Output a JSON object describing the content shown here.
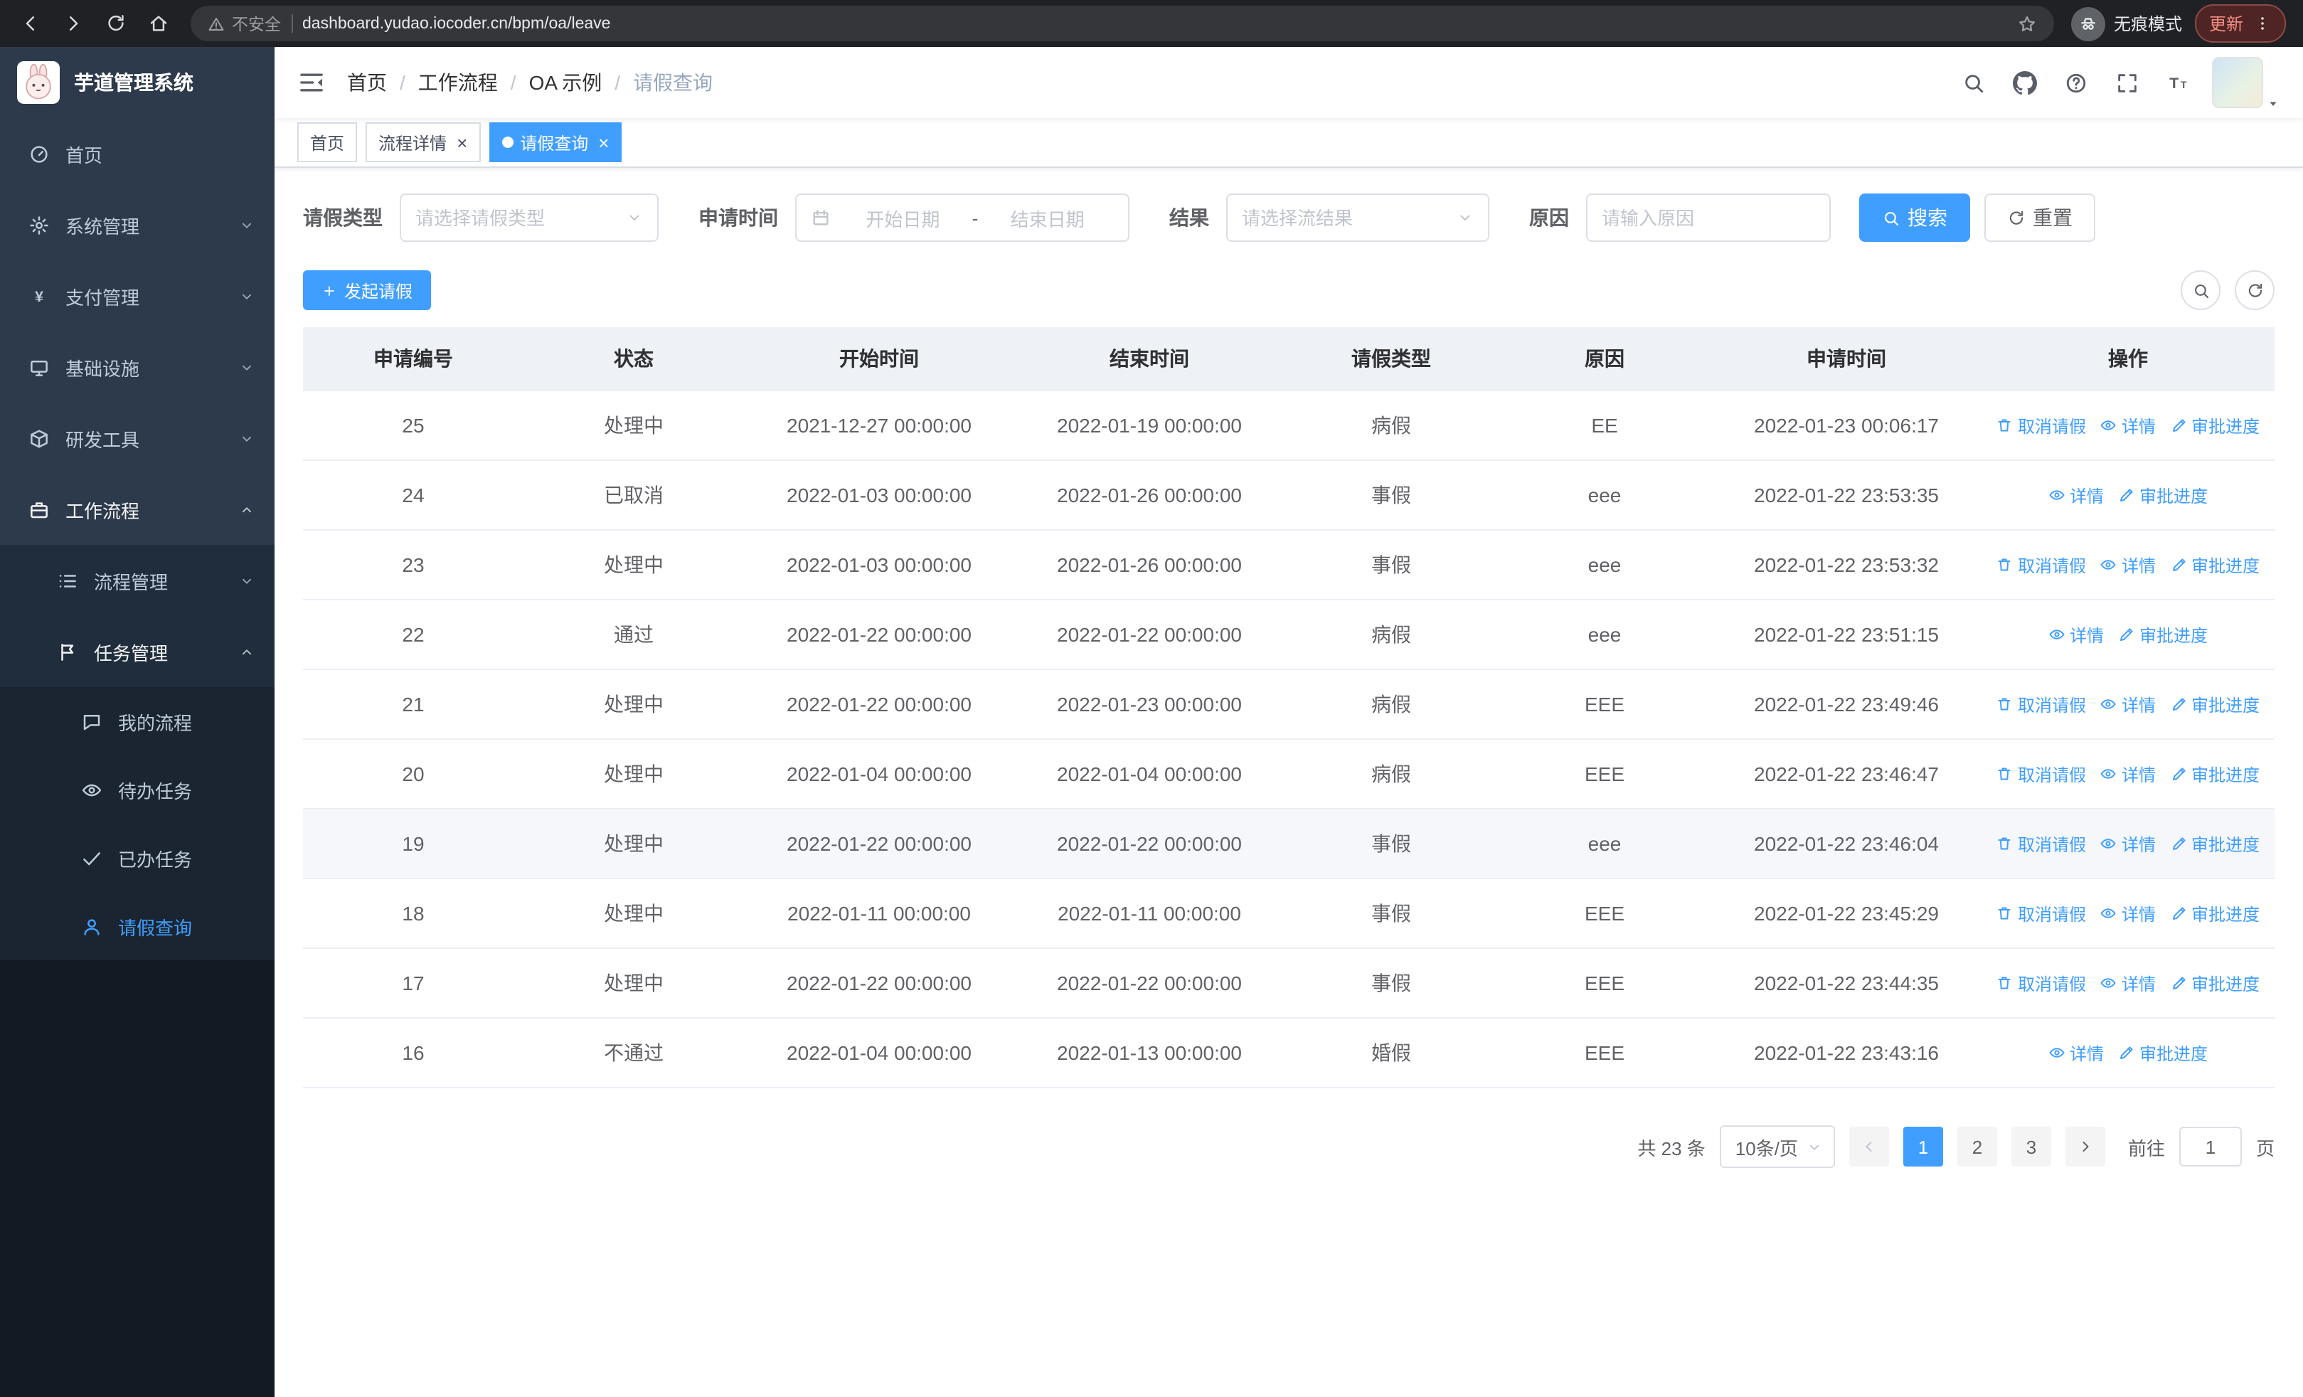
{
  "colors": {
    "primary": "#409eff"
  },
  "browser": {
    "security_label": "不安全",
    "url": "dashboard.yudao.iocoder.cn/bpm/oa/leave",
    "incognito_label": "无痕模式",
    "update_label": "更新"
  },
  "sidebar": {
    "title": "芋道管理系统",
    "menu": [
      {
        "key": "home",
        "icon": "dashboard",
        "label": "首页"
      },
      {
        "key": "system-mgmt",
        "icon": "gear",
        "label": "系统管理",
        "expand": "down"
      },
      {
        "key": "payment-mgmt",
        "icon": "yen",
        "label": "支付管理",
        "expand": "down"
      },
      {
        "key": "infrastructure",
        "icon": "monitor",
        "label": "基础设施",
        "expand": "down"
      },
      {
        "key": "dev-tools",
        "icon": "box",
        "label": "研发工具",
        "expand": "down"
      },
      {
        "key": "workflow",
        "icon": "briefcase",
        "label": "工作流程",
        "expand": "up",
        "open": true,
        "children": [
          {
            "key": "process-mgmt",
            "icon": "list",
            "label": "流程管理",
            "expand": "down"
          },
          {
            "key": "task-mgmt",
            "icon": "flag",
            "label": "任务管理",
            "expand": "up",
            "open": true,
            "children": [
              {
                "key": "my-process",
                "icon": "chat",
                "label": "我的流程"
              },
              {
                "key": "todo-tasks",
                "icon": "eye",
                "label": "待办任务"
              },
              {
                "key": "done-tasks",
                "icon": "check",
                "label": "已办任务"
              },
              {
                "key": "leave-query",
                "icon": "user",
                "label": "请假查询",
                "active": true
              }
            ]
          }
        ]
      }
    ]
  },
  "header": {
    "breadcrumb": [
      "首页",
      "工作流程",
      "OA 示例",
      "请假查询"
    ],
    "tools": [
      {
        "key": "search"
      },
      {
        "key": "github"
      },
      {
        "key": "help"
      },
      {
        "key": "fullscreen"
      },
      {
        "key": "font-size"
      }
    ]
  },
  "tabs": [
    {
      "key": "home",
      "label": "首页",
      "closable": false,
      "active": false
    },
    {
      "key": "process-detail",
      "label": "流程详情",
      "closable": true,
      "active": false
    },
    {
      "key": "leave-query",
      "label": "请假查询",
      "closable": true,
      "active": true
    }
  ],
  "filters": {
    "leave_type_label": "请假类型",
    "leave_type_placeholder": "请选择请假类型",
    "apply_time_label": "申请时间",
    "date_start_placeholder": "开始日期",
    "date_separator": "-",
    "date_end_placeholder": "结束日期",
    "result_label": "结果",
    "result_placeholder": "请选择流结果",
    "reason_label": "原因",
    "reason_placeholder": "请输入原因",
    "search_label": "搜索",
    "reset_label": "重置"
  },
  "toolbar": {
    "create_label": "发起请假"
  },
  "table": {
    "headers": [
      "申请编号",
      "状态",
      "开始时间",
      "结束时间",
      "请假类型",
      "原因",
      "申请时间",
      "操作"
    ],
    "action_labels": {
      "cancel": "取消请假",
      "detail": "详情",
      "progress": "审批进度"
    },
    "hover_row_id": "19",
    "rows": [
      {
        "id": "25",
        "status": "处理中",
        "start": "2021-12-27 00:00:00",
        "end": "2022-01-19 00:00:00",
        "type": "病假",
        "reason": "EE",
        "applied": "2022-01-23 00:06:17",
        "actions": [
          "cancel",
          "detail",
          "progress"
        ]
      },
      {
        "id": "24",
        "status": "已取消",
        "start": "2022-01-03 00:00:00",
        "end": "2022-01-26 00:00:00",
        "type": "事假",
        "reason": "eee",
        "applied": "2022-01-22 23:53:35",
        "actions": [
          "detail",
          "progress"
        ]
      },
      {
        "id": "23",
        "status": "处理中",
        "start": "2022-01-03 00:00:00",
        "end": "2022-01-26 00:00:00",
        "type": "事假",
        "reason": "eee",
        "applied": "2022-01-22 23:53:32",
        "actions": [
          "cancel",
          "detail",
          "progress"
        ]
      },
      {
        "id": "22",
        "status": "通过",
        "start": "2022-01-22 00:00:00",
        "end": "2022-01-22 00:00:00",
        "type": "病假",
        "reason": "eee",
        "applied": "2022-01-22 23:51:15",
        "actions": [
          "detail",
          "progress"
        ]
      },
      {
        "id": "21",
        "status": "处理中",
        "start": "2022-01-22 00:00:00",
        "end": "2022-01-23 00:00:00",
        "type": "病假",
        "reason": "EEE",
        "applied": "2022-01-22 23:49:46",
        "actions": [
          "cancel",
          "detail",
          "progress"
        ]
      },
      {
        "id": "20",
        "status": "处理中",
        "start": "2022-01-04 00:00:00",
        "end": "2022-01-04 00:00:00",
        "type": "病假",
        "reason": "EEE",
        "applied": "2022-01-22 23:46:47",
        "actions": [
          "cancel",
          "detail",
          "progress"
        ]
      },
      {
        "id": "19",
        "status": "处理中",
        "start": "2022-01-22 00:00:00",
        "end": "2022-01-22 00:00:00",
        "type": "事假",
        "reason": "eee",
        "applied": "2022-01-22 23:46:04",
        "actions": [
          "cancel",
          "detail",
          "progress"
        ]
      },
      {
        "id": "18",
        "status": "处理中",
        "start": "2022-01-11 00:00:00",
        "end": "2022-01-11 00:00:00",
        "type": "事假",
        "reason": "EEE",
        "applied": "2022-01-22 23:45:29",
        "actions": [
          "cancel",
          "detail",
          "progress"
        ]
      },
      {
        "id": "17",
        "status": "处理中",
        "start": "2022-01-22 00:00:00",
        "end": "2022-01-22 00:00:00",
        "type": "事假",
        "reason": "EEE",
        "applied": "2022-01-22 23:44:35",
        "actions": [
          "cancel",
          "detail",
          "progress"
        ]
      },
      {
        "id": "16",
        "status": "不通过",
        "start": "2022-01-04 00:00:00",
        "end": "2022-01-13 00:00:00",
        "type": "婚假",
        "reason": "EEE",
        "applied": "2022-01-22 23:43:16",
        "actions": [
          "detail",
          "progress"
        ]
      }
    ]
  },
  "pagination": {
    "total": "共 23 条",
    "page_size": "10条/页",
    "pages": [
      "1",
      "2",
      "3"
    ],
    "active_page": "1",
    "goto_label": "前往",
    "goto_value": "1",
    "page_label": "页"
  }
}
